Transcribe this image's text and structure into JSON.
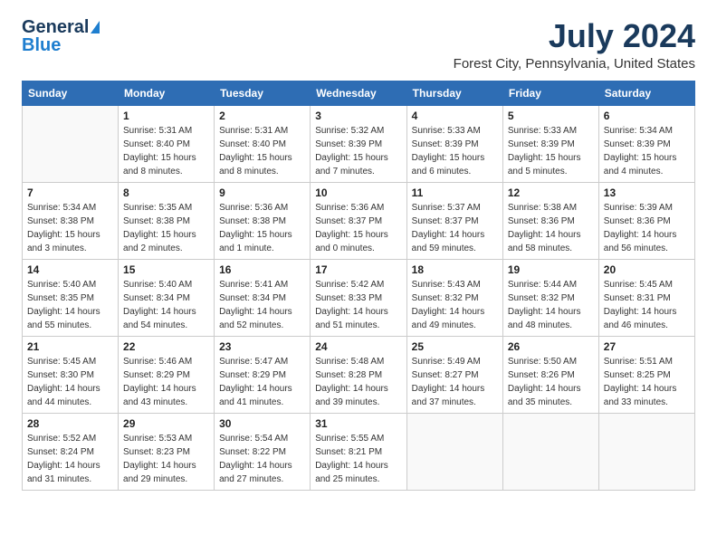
{
  "logo": {
    "general": "General",
    "blue": "Blue"
  },
  "title": {
    "month_year": "July 2024",
    "location": "Forest City, Pennsylvania, United States"
  },
  "days_of_week": [
    "Sunday",
    "Monday",
    "Tuesday",
    "Wednesday",
    "Thursday",
    "Friday",
    "Saturday"
  ],
  "weeks": [
    [
      {
        "day": "",
        "info": ""
      },
      {
        "day": "1",
        "info": "Sunrise: 5:31 AM\nSunset: 8:40 PM\nDaylight: 15 hours\nand 8 minutes."
      },
      {
        "day": "2",
        "info": "Sunrise: 5:31 AM\nSunset: 8:40 PM\nDaylight: 15 hours\nand 8 minutes."
      },
      {
        "day": "3",
        "info": "Sunrise: 5:32 AM\nSunset: 8:39 PM\nDaylight: 15 hours\nand 7 minutes."
      },
      {
        "day": "4",
        "info": "Sunrise: 5:33 AM\nSunset: 8:39 PM\nDaylight: 15 hours\nand 6 minutes."
      },
      {
        "day": "5",
        "info": "Sunrise: 5:33 AM\nSunset: 8:39 PM\nDaylight: 15 hours\nand 5 minutes."
      },
      {
        "day": "6",
        "info": "Sunrise: 5:34 AM\nSunset: 8:39 PM\nDaylight: 15 hours\nand 4 minutes."
      }
    ],
    [
      {
        "day": "7",
        "info": "Sunrise: 5:34 AM\nSunset: 8:38 PM\nDaylight: 15 hours\nand 3 minutes."
      },
      {
        "day": "8",
        "info": "Sunrise: 5:35 AM\nSunset: 8:38 PM\nDaylight: 15 hours\nand 2 minutes."
      },
      {
        "day": "9",
        "info": "Sunrise: 5:36 AM\nSunset: 8:38 PM\nDaylight: 15 hours\nand 1 minute."
      },
      {
        "day": "10",
        "info": "Sunrise: 5:36 AM\nSunset: 8:37 PM\nDaylight: 15 hours\nand 0 minutes."
      },
      {
        "day": "11",
        "info": "Sunrise: 5:37 AM\nSunset: 8:37 PM\nDaylight: 14 hours\nand 59 minutes."
      },
      {
        "day": "12",
        "info": "Sunrise: 5:38 AM\nSunset: 8:36 PM\nDaylight: 14 hours\nand 58 minutes."
      },
      {
        "day": "13",
        "info": "Sunrise: 5:39 AM\nSunset: 8:36 PM\nDaylight: 14 hours\nand 56 minutes."
      }
    ],
    [
      {
        "day": "14",
        "info": "Sunrise: 5:40 AM\nSunset: 8:35 PM\nDaylight: 14 hours\nand 55 minutes."
      },
      {
        "day": "15",
        "info": "Sunrise: 5:40 AM\nSunset: 8:34 PM\nDaylight: 14 hours\nand 54 minutes."
      },
      {
        "day": "16",
        "info": "Sunrise: 5:41 AM\nSunset: 8:34 PM\nDaylight: 14 hours\nand 52 minutes."
      },
      {
        "day": "17",
        "info": "Sunrise: 5:42 AM\nSunset: 8:33 PM\nDaylight: 14 hours\nand 51 minutes."
      },
      {
        "day": "18",
        "info": "Sunrise: 5:43 AM\nSunset: 8:32 PM\nDaylight: 14 hours\nand 49 minutes."
      },
      {
        "day": "19",
        "info": "Sunrise: 5:44 AM\nSunset: 8:32 PM\nDaylight: 14 hours\nand 48 minutes."
      },
      {
        "day": "20",
        "info": "Sunrise: 5:45 AM\nSunset: 8:31 PM\nDaylight: 14 hours\nand 46 minutes."
      }
    ],
    [
      {
        "day": "21",
        "info": "Sunrise: 5:45 AM\nSunset: 8:30 PM\nDaylight: 14 hours\nand 44 minutes."
      },
      {
        "day": "22",
        "info": "Sunrise: 5:46 AM\nSunset: 8:29 PM\nDaylight: 14 hours\nand 43 minutes."
      },
      {
        "day": "23",
        "info": "Sunrise: 5:47 AM\nSunset: 8:29 PM\nDaylight: 14 hours\nand 41 minutes."
      },
      {
        "day": "24",
        "info": "Sunrise: 5:48 AM\nSunset: 8:28 PM\nDaylight: 14 hours\nand 39 minutes."
      },
      {
        "day": "25",
        "info": "Sunrise: 5:49 AM\nSunset: 8:27 PM\nDaylight: 14 hours\nand 37 minutes."
      },
      {
        "day": "26",
        "info": "Sunrise: 5:50 AM\nSunset: 8:26 PM\nDaylight: 14 hours\nand 35 minutes."
      },
      {
        "day": "27",
        "info": "Sunrise: 5:51 AM\nSunset: 8:25 PM\nDaylight: 14 hours\nand 33 minutes."
      }
    ],
    [
      {
        "day": "28",
        "info": "Sunrise: 5:52 AM\nSunset: 8:24 PM\nDaylight: 14 hours\nand 31 minutes."
      },
      {
        "day": "29",
        "info": "Sunrise: 5:53 AM\nSunset: 8:23 PM\nDaylight: 14 hours\nand 29 minutes."
      },
      {
        "day": "30",
        "info": "Sunrise: 5:54 AM\nSunset: 8:22 PM\nDaylight: 14 hours\nand 27 minutes."
      },
      {
        "day": "31",
        "info": "Sunrise: 5:55 AM\nSunset: 8:21 PM\nDaylight: 14 hours\nand 25 minutes."
      },
      {
        "day": "",
        "info": ""
      },
      {
        "day": "",
        "info": ""
      },
      {
        "day": "",
        "info": ""
      }
    ]
  ]
}
